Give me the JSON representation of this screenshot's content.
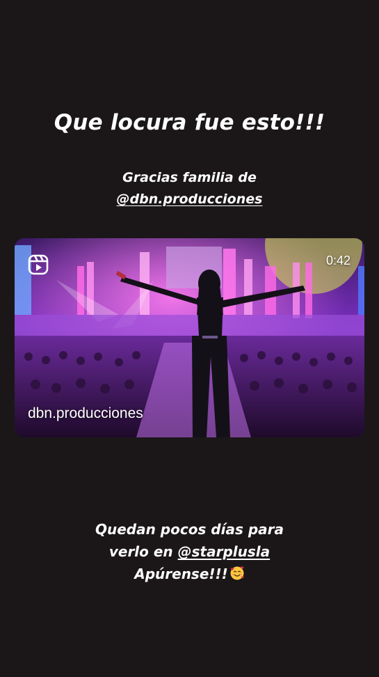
{
  "story": {
    "headline": "Que locura fue esto!!!",
    "thanks_line": "Gracias familia de",
    "thanks_mention": "@dbn.producciones",
    "reel": {
      "duration": "0:42",
      "account": "dbn.producciones",
      "icon": "reels-icon"
    },
    "closing_line1": "Quedan pocos días para",
    "closing_line2_prefix": "verlo en ",
    "closing_mention": "@starplusla",
    "closing_line3": "Apúrense!!!",
    "closing_emoji": "smiling-face-with-hearts-emoji"
  },
  "colors": {
    "background": "#1b1719",
    "text": "#ffffff",
    "stage_purple": "#8a2be2",
    "stage_pink": "#ff4fd8"
  }
}
